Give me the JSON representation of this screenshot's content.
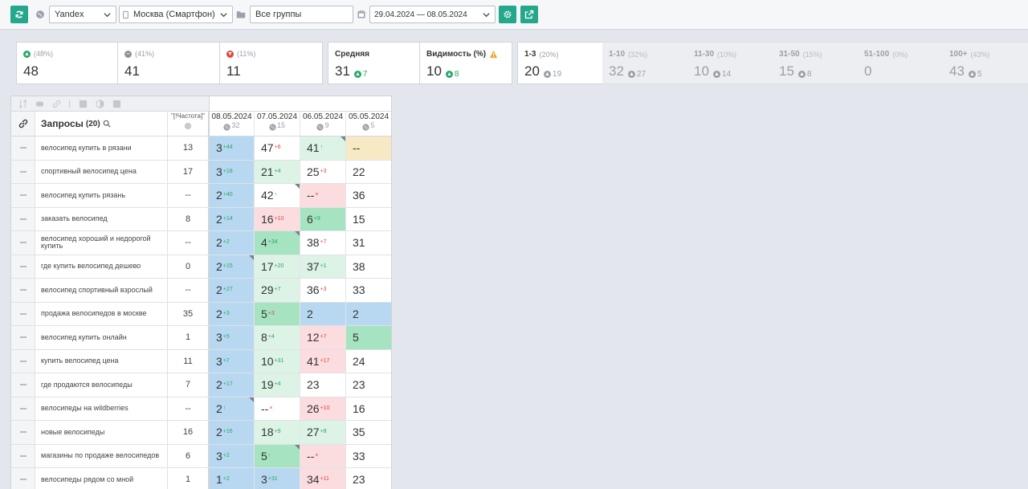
{
  "toolbar": {
    "engine": "Yandex",
    "region": "Москва (Смартфон)",
    "group": "Все группы",
    "date_range": "29.04.2024 — 08.05.2024"
  },
  "summary": {
    "up": {
      "pct": "(48%)",
      "value": "48"
    },
    "same": {
      "pct": "(41%)",
      "value": "41"
    },
    "down": {
      "pct": "(11%)",
      "value": "11"
    },
    "avg": {
      "label": "Средняя",
      "value": "31",
      "delta": "7"
    },
    "visibility": {
      "label": "Видимость (%)",
      "value": "10",
      "delta": "8"
    },
    "ranges": [
      {
        "label": "1-3",
        "pct": "(20%)",
        "value": "20",
        "delta": "19",
        "active": true
      },
      {
        "label": "1-10",
        "pct": "(32%)",
        "value": "32",
        "delta": "27",
        "active": false
      },
      {
        "label": "11-30",
        "pct": "(10%)",
        "value": "10",
        "delta": "14",
        "active": false
      },
      {
        "label": "31-50",
        "pct": "(15%)",
        "value": "15",
        "delta": "8",
        "active": false
      },
      {
        "label": "51-100",
        "pct": "(0%)",
        "value": "0",
        "delta": "",
        "active": false
      },
      {
        "label": "100+",
        "pct": "(43%)",
        "value": "43",
        "delta": "5",
        "active": false
      }
    ]
  },
  "table": {
    "queries_label": "Запросы",
    "queries_count": "(20)",
    "freq_label": "\"[!Частота]\"",
    "dates": [
      {
        "date": "08.05.2024",
        "num": "32"
      },
      {
        "date": "07.05.2024",
        "num": "15"
      },
      {
        "date": "06.05.2024",
        "num": "9"
      },
      {
        "date": "05.05.2024",
        "num": "5"
      }
    ],
    "rows": [
      {
        "q": "велосипед купить в рязани",
        "f": "13",
        "c": [
          [
            "3",
            "+44",
            "up",
            "blue",
            0
          ],
          [
            "47",
            "+6",
            "down",
            "white",
            0
          ],
          [
            "41",
            "↑",
            "up",
            "lgreen",
            1
          ],
          [
            "--",
            "",
            "",
            "yellow",
            0
          ]
        ]
      },
      {
        "q": "спортивный велосипед цена",
        "f": "17",
        "c": [
          [
            "3",
            "+18",
            "up",
            "blue",
            0
          ],
          [
            "21",
            "+4",
            "up",
            "lgreen",
            0
          ],
          [
            "25",
            "+3",
            "down",
            "white",
            0
          ],
          [
            "22",
            "",
            "",
            "white",
            0
          ]
        ]
      },
      {
        "q": "велосипед купить рязань",
        "f": "--",
        "c": [
          [
            "2",
            "+40",
            "up",
            "blue",
            0
          ],
          [
            "42",
            "↑",
            "up",
            "white",
            1
          ],
          [
            "--",
            "×",
            "down",
            "red",
            0
          ],
          [
            "36",
            "",
            "",
            "white",
            0
          ]
        ]
      },
      {
        "q": "заказать велосипед",
        "f": "8",
        "c": [
          [
            "2",
            "+14",
            "up",
            "blue",
            0
          ],
          [
            "16",
            "+10",
            "down",
            "red",
            0
          ],
          [
            "6",
            "+9",
            "up",
            "green",
            0
          ],
          [
            "15",
            "",
            "",
            "white",
            0
          ]
        ]
      },
      {
        "q": "велосипед хороший и недорогой купить",
        "f": "--",
        "c": [
          [
            "2",
            "+2",
            "up",
            "blue",
            0
          ],
          [
            "4",
            "+34",
            "up",
            "green",
            1
          ],
          [
            "38",
            "+7",
            "down",
            "white",
            0
          ],
          [
            "31",
            "",
            "",
            "white",
            0
          ]
        ]
      },
      {
        "q": "где купить велосипед дешево",
        "f": "0",
        "c": [
          [
            "2",
            "+15",
            "up",
            "blue",
            1
          ],
          [
            "17",
            "+20",
            "up",
            "lgreen",
            0
          ],
          [
            "37",
            "+1",
            "up",
            "lgreen",
            0
          ],
          [
            "38",
            "",
            "",
            "white",
            0
          ]
        ]
      },
      {
        "q": "велосипед спортивный взрослый",
        "f": "--",
        "c": [
          [
            "2",
            "+27",
            "up",
            "blue",
            0
          ],
          [
            "29",
            "+7",
            "up",
            "lgreen",
            0
          ],
          [
            "36",
            "+3",
            "down",
            "white",
            0
          ],
          [
            "33",
            "",
            "",
            "white",
            0
          ]
        ]
      },
      {
        "q": "продажа велосипедов в москве",
        "f": "35",
        "c": [
          [
            "2",
            "+3",
            "up",
            "blue",
            0
          ],
          [
            "5",
            "+3",
            "down",
            "green",
            0
          ],
          [
            "2",
            "",
            "",
            "blue",
            0
          ],
          [
            "2",
            "",
            "",
            "blue",
            0
          ]
        ]
      },
      {
        "q": "велосипед купить онлайн",
        "f": "1",
        "c": [
          [
            "3",
            "+5",
            "up",
            "blue",
            0
          ],
          [
            "8",
            "+4",
            "up",
            "lgreen",
            0
          ],
          [
            "12",
            "+7",
            "down",
            "red",
            0
          ],
          [
            "5",
            "",
            "",
            "green",
            0
          ]
        ]
      },
      {
        "q": "купить велосипед цена",
        "f": "11",
        "c": [
          [
            "3",
            "+7",
            "up",
            "blue",
            0
          ],
          [
            "10",
            "+31",
            "up",
            "lgreen",
            0
          ],
          [
            "41",
            "+17",
            "down",
            "red",
            0
          ],
          [
            "24",
            "",
            "",
            "white",
            0
          ]
        ]
      },
      {
        "q": "где продаются велосипеды",
        "f": "7",
        "c": [
          [
            "2",
            "+17",
            "up",
            "blue",
            0
          ],
          [
            "19",
            "+4",
            "up",
            "lgreen",
            0
          ],
          [
            "23",
            "",
            "",
            "white",
            0
          ],
          [
            "23",
            "",
            "",
            "white",
            0
          ]
        ]
      },
      {
        "q": "велосипеды на wildberries",
        "f": "--",
        "c": [
          [
            "2",
            "↑",
            "up",
            "blue",
            1
          ],
          [
            "--",
            "×",
            "down",
            "white",
            0
          ],
          [
            "26",
            "+10",
            "down",
            "red",
            0
          ],
          [
            "16",
            "",
            "",
            "white",
            0
          ]
        ]
      },
      {
        "q": "новые велосипеды",
        "f": "16",
        "c": [
          [
            "2",
            "+16",
            "up",
            "blue",
            0
          ],
          [
            "18",
            "+9",
            "up",
            "lgreen",
            0
          ],
          [
            "27",
            "+8",
            "up",
            "lgreen",
            0
          ],
          [
            "35",
            "",
            "",
            "white",
            0
          ]
        ]
      },
      {
        "q": "магазины по продаже велосипедов",
        "f": "6",
        "c": [
          [
            "3",
            "+2",
            "up",
            "blue",
            0
          ],
          [
            "5",
            "↑",
            "up",
            "green",
            1
          ],
          [
            "--",
            "×",
            "down",
            "red",
            0
          ],
          [
            "33",
            "",
            "",
            "white",
            0
          ]
        ]
      },
      {
        "q": "велосипеды рядом со мной",
        "f": "1",
        "c": [
          [
            "1",
            "+2",
            "up",
            "blue",
            0
          ],
          [
            "3",
            "+31",
            "up",
            "blue",
            0
          ],
          [
            "34",
            "+11",
            "down",
            "red",
            0
          ],
          [
            "23",
            "",
            "",
            "white",
            0
          ]
        ]
      }
    ]
  }
}
